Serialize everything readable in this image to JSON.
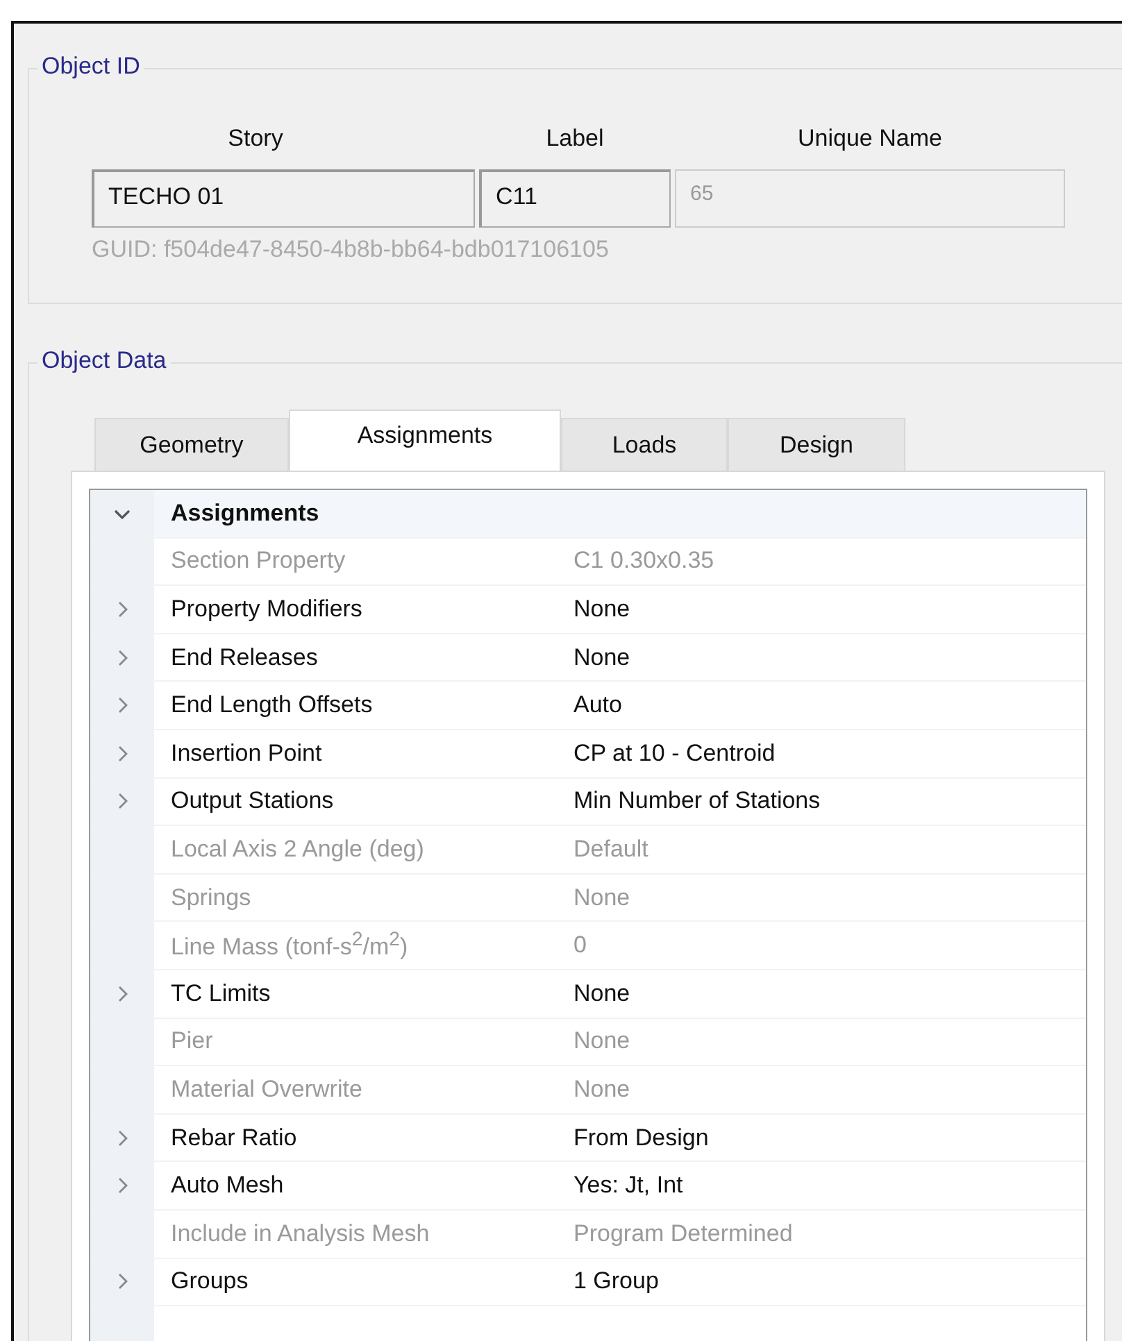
{
  "object_id": {
    "title": "Object ID",
    "columns": [
      "Story",
      "Label",
      "Unique Name"
    ],
    "fields": [
      {
        "value": "TECHO 01",
        "disabled": false
      },
      {
        "value": "C11",
        "disabled": false
      },
      {
        "value": "65",
        "disabled": true
      }
    ],
    "guid": "GUID: f504de47-8450-4b8b-bb64-bdb017106105"
  },
  "object_data": {
    "title": "Object Data",
    "tabs": [
      {
        "label": "Geometry",
        "selected": false
      },
      {
        "label": "Assignments",
        "selected": true
      },
      {
        "label": "Loads",
        "selected": false
      },
      {
        "label": "Design",
        "selected": false
      }
    ],
    "category": {
      "label": "Assignments",
      "expanded": true
    },
    "properties": [
      {
        "label": "Section Property",
        "value": "C1 0.30x0.35",
        "expandable": false,
        "disabled": true
      },
      {
        "label": "Property Modifiers",
        "value": "None",
        "expandable": true,
        "disabled": false
      },
      {
        "label": "End Releases",
        "value": "None",
        "expandable": true,
        "disabled": false
      },
      {
        "label": "End Length Offsets",
        "value": "Auto",
        "expandable": true,
        "disabled": false
      },
      {
        "label": "Insertion Point",
        "value": "CP at 10 - Centroid",
        "expandable": true,
        "disabled": false
      },
      {
        "label": "Output Stations",
        "value": "Min Number of Stations",
        "expandable": true,
        "disabled": false
      },
      {
        "label": "Local Axis 2 Angle (deg)",
        "value": "Default",
        "expandable": false,
        "disabled": true
      },
      {
        "label": "Springs",
        "value": "None",
        "expandable": false,
        "disabled": true
      },
      {
        "label": "Line Mass (tonf-s$^{2}$/m$^{2}$)",
        "value": "0",
        "expandable": false,
        "disabled": true
      },
      {
        "label": "TC Limits",
        "value": "None",
        "expandable": true,
        "disabled": false
      },
      {
        "label": "Pier",
        "value": "None",
        "expandable": false,
        "disabled": true
      },
      {
        "label": "Material Overwrite",
        "value": "None",
        "expandable": false,
        "disabled": true
      },
      {
        "label": "Rebar Ratio",
        "value": "From Design",
        "expandable": true,
        "disabled": false
      },
      {
        "label": "Auto Mesh",
        "value": "Yes: Jt, Int",
        "expandable": true,
        "disabled": false
      },
      {
        "label": "Include in Analysis Mesh",
        "value": "Program Determined",
        "expandable": false,
        "disabled": true
      },
      {
        "label": "Groups",
        "value": "1 Group",
        "expandable": true,
        "disabled": false
      }
    ]
  }
}
